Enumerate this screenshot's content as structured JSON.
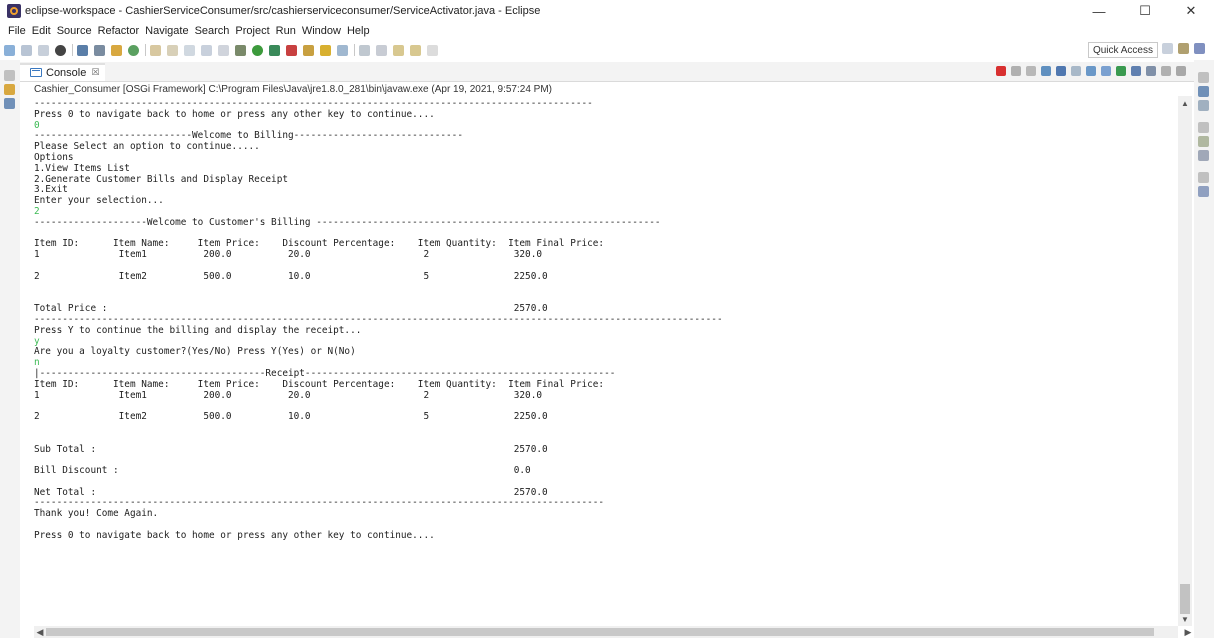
{
  "window": {
    "title": "eclipse-workspace - CashierServiceConsumer/src/cashierserviceconsumer/ServiceActivator.java - Eclipse",
    "minimize": "—",
    "maximize": "☐",
    "close": "✕"
  },
  "menu": [
    "File",
    "Edit",
    "Source",
    "Refactor",
    "Navigate",
    "Search",
    "Project",
    "Run",
    "Window",
    "Help"
  ],
  "toolbar": {
    "quick_access": "Quick Access"
  },
  "view": {
    "tab_label": "Console",
    "tab_close": "☒",
    "process_header": "Cashier_Consumer [OSGi Framework] C:\\Program Files\\Java\\jre1.8.0_281\\bin\\javaw.exe (Apr 19, 2021, 9:57:24 PM)"
  },
  "console_lines": [
    {
      "text": "---------------------------------------------------------------------------------------------------",
      "input": false
    },
    {
      "text": "Press 0 to navigate back to home or press any other key to continue....",
      "input": false
    },
    {
      "text": "0",
      "input": true
    },
    {
      "text": "----------------------------Welcome to Billing------------------------------",
      "input": false
    },
    {
      "text": "Please Select an option to continue.....",
      "input": false
    },
    {
      "text": "Options",
      "input": false
    },
    {
      "text": "1.View Items List",
      "input": false
    },
    {
      "text": "2.Generate Customer Bills and Display Receipt",
      "input": false
    },
    {
      "text": "3.Exit",
      "input": false
    },
    {
      "text": "Enter your selection...",
      "input": false
    },
    {
      "text": "2",
      "input": true
    },
    {
      "text": "--------------------Welcome to Customer's Billing -------------------------------------------------------------",
      "input": false
    },
    {
      "text": "",
      "input": false
    },
    {
      "text": "Item ID:      Item Name:     Item Price:    Discount Percentage:    Item Quantity:  Item Final Price:",
      "input": false
    },
    {
      "text": "1              Item1          200.0          20.0                    2               320.0",
      "input": false
    },
    {
      "text": "",
      "input": false
    },
    {
      "text": "2              Item2          500.0          10.0                    5               2250.0",
      "input": false
    },
    {
      "text": "",
      "input": false
    },
    {
      "text": "",
      "input": false
    },
    {
      "text": "Total Price :                                                                        2570.0",
      "input": false
    },
    {
      "text": "--------------------------------------------------------------------------------------------------------------------------",
      "input": false
    },
    {
      "text": "Press Y to continue the billing and display the receipt...",
      "input": false
    },
    {
      "text": "y",
      "input": true
    },
    {
      "text": "Are you a loyalty customer?(Yes/No) Press Y(Yes) or N(No)",
      "input": false
    },
    {
      "text": "n",
      "input": true
    },
    {
      "text": "|----------------------------------------Receipt-------------------------------------------------------",
      "input": false
    },
    {
      "text": "Item ID:      Item Name:     Item Price:    Discount Percentage:    Item Quantity:  Item Final Price:",
      "input": false
    },
    {
      "text": "1              Item1          200.0          20.0                    2               320.0",
      "input": false
    },
    {
      "text": "",
      "input": false
    },
    {
      "text": "2              Item2          500.0          10.0                    5               2250.0",
      "input": false
    },
    {
      "text": "",
      "input": false
    },
    {
      "text": "",
      "input": false
    },
    {
      "text": "Sub Total :                                                                          2570.0",
      "input": false
    },
    {
      "text": "",
      "input": false
    },
    {
      "text": "Bill Discount :                                                                      0.0",
      "input": false
    },
    {
      "text": "",
      "input": false
    },
    {
      "text": "Net Total :                                                                          2570.0",
      "input": false
    },
    {
      "text": "-----------------------------------------------------------------------------------------------------",
      "input": false
    },
    {
      "text": "Thank you! Come Again.",
      "input": false
    },
    {
      "text": "",
      "input": false
    },
    {
      "text": "Press 0 to navigate back to home or press any other key to continue....",
      "input": false
    }
  ],
  "colors": {
    "user_input": "#3cba54",
    "console_text": "#1e1e1e",
    "tab_accent": "#3a78c0"
  }
}
